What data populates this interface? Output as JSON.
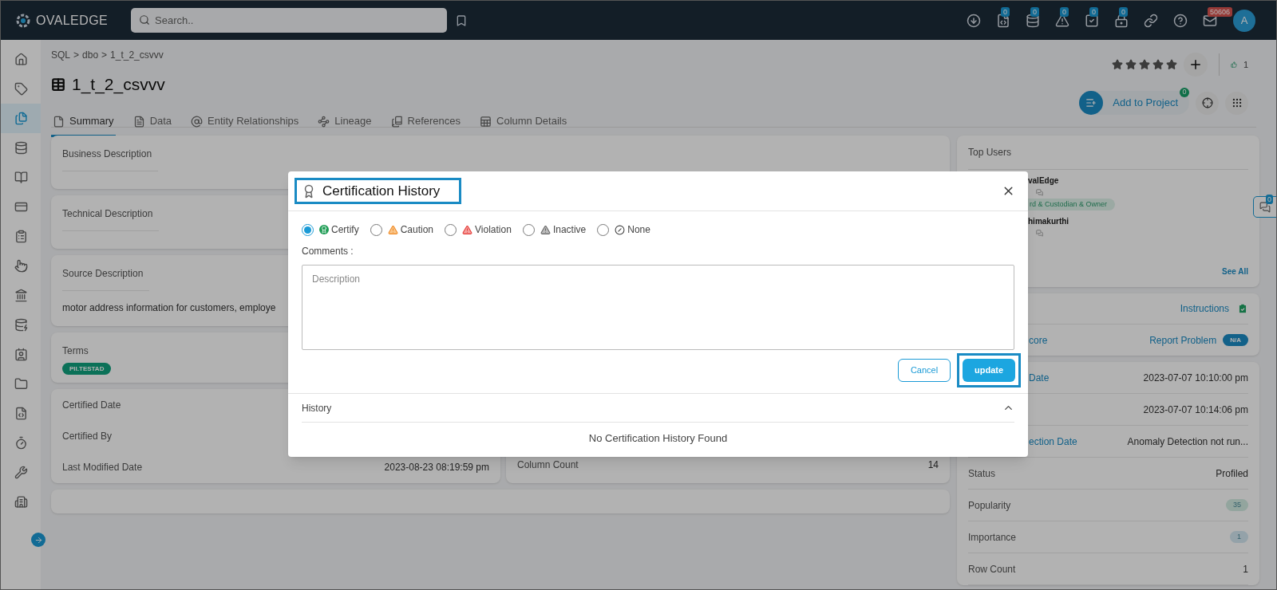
{
  "top_bar": {
    "logo": "OVALEDGE",
    "search": {
      "placeholder": "Search.."
    },
    "icons": [
      {
        "kind": "download"
      },
      {
        "kind": "code",
        "badge": "0"
      },
      {
        "kind": "database",
        "badge": "0"
      },
      {
        "kind": "warning",
        "badge": "0"
      },
      {
        "kind": "task",
        "badge": "0"
      },
      {
        "kind": "lock",
        "badge": "0"
      },
      {
        "kind": "link"
      },
      {
        "kind": "help"
      },
      {
        "kind": "mail",
        "badge": "50606"
      }
    ],
    "avatar": "A"
  },
  "sidebar": {
    "items": [
      {
        "selected": false
      },
      {
        "selected": false
      },
      {
        "selected": true
      },
      {
        "selected": false
      },
      {
        "selected": false
      },
      {
        "selected": false
      },
      {
        "selected": false
      },
      {
        "selected": false
      },
      {
        "selected": false
      },
      {
        "selected": false
      },
      {
        "selected": false
      },
      {
        "selected": false
      },
      {
        "selected": false
      },
      {
        "selected": false
      },
      {
        "selected": false
      },
      {
        "selected": false
      }
    ]
  },
  "breadcrumb": [
    {
      "label": "SQL",
      "separator": ">"
    },
    {
      "label": "dbo",
      "separator": ">"
    },
    {
      "label": "1_t_2_csvvv"
    }
  ],
  "title": "1_t_2_csvvv",
  "rating": {
    "stars": 5
  },
  "like_count": "1",
  "tabs": [
    {
      "label": "Summary",
      "selected": true
    },
    {
      "label": "Data",
      "selected": false
    },
    {
      "label": "Entity Relationships",
      "selected": false
    },
    {
      "label": "Lineage",
      "selected": false
    },
    {
      "label": "References",
      "selected": false
    },
    {
      "label": "Column Details",
      "selected": false
    }
  ],
  "add_to_project": {
    "label": "Add to Project",
    "badge": "0"
  },
  "description_cards": [
    {
      "label": "Business Description"
    },
    {
      "label": "Technical Description"
    },
    {
      "label": "Source Description",
      "text": "motor address information for customers, employe"
    }
  ],
  "terms": {
    "label": "Terms",
    "tags": [
      "PII.TESTAD"
    ]
  },
  "certification_rows": [
    {
      "label": "Certified Date"
    },
    {
      "label": "Certified By"
    },
    {
      "label": "Last Modified Date",
      "value": "2023-08-23 08:19:59 pm"
    }
  ],
  "column_rows": [
    {
      "label": "Column Count",
      "value": "14"
    }
  ],
  "top_users": {
    "title": "Top Users",
    "users": [
      {
        "name": "valEdge",
        "roles": "rd & Custodian & Owner"
      },
      {
        "name": "himakurthi"
      }
    ],
    "see_all": "See All"
  },
  "quality": {
    "instructions": "Instructions",
    "score": "core",
    "report_problem": "Report Problem",
    "report_badge": "N/A"
  },
  "details": [
    {
      "kind": "link",
      "label": "Date",
      "value": "2023-07-07 10:10:00 pm"
    },
    {
      "kind": "link",
      "value": "2023-07-07 10:14:06 pm"
    },
    {
      "kind": "link",
      "label": "ection Date",
      "value": "Anomaly Detection not run..."
    },
    {
      "kind": "text",
      "label": "Status",
      "value": "Profiled"
    },
    {
      "kind": "badge",
      "label": "Popularity",
      "value": "35",
      "color": "#93a59e"
    },
    {
      "kind": "badge",
      "label": "Importance",
      "value": "1",
      "color": "#94a2a9"
    },
    {
      "kind": "text",
      "label": "Row Count",
      "value": "1"
    }
  ],
  "chat_badge": "0",
  "modal": {
    "title": "Certification History",
    "title_highlighted": true,
    "options": [
      {
        "kind": "certify",
        "label": "Certify",
        "selected": true
      },
      {
        "kind": "caution",
        "label": "Caution",
        "selected": false
      },
      {
        "kind": "violation",
        "label": "Violation",
        "selected": false
      },
      {
        "kind": "inactive",
        "label": "Inactive",
        "selected": false
      },
      {
        "kind": "none",
        "label": "None",
        "selected": false
      }
    ],
    "comments_label": "Comments :",
    "comments": {
      "placeholder": "Description"
    },
    "cancel": "Cancel",
    "update": "update",
    "update_highlighted": true,
    "history": {
      "title": "History",
      "expanded": true,
      "empty": "No Certification History Found"
    }
  }
}
